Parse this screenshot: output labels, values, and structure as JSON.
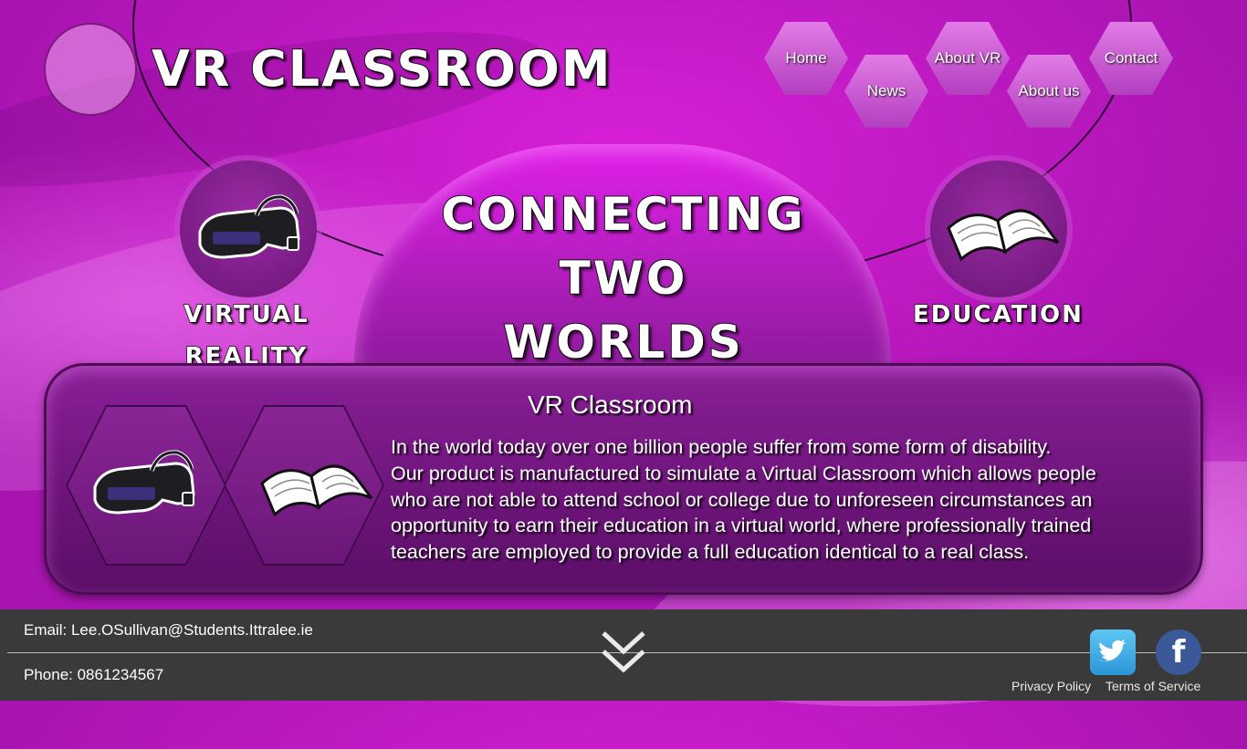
{
  "header": {
    "logo_title": "VR CLASSROOM"
  },
  "nav": {
    "home": "Home",
    "news": "News",
    "about_vr": "About VR",
    "about_us": "About us",
    "contact": "Contact"
  },
  "hero": {
    "line1": "CONNECTING",
    "line2": "TWO",
    "line3": "WORLDS"
  },
  "features": {
    "vr_line1": "VIRTUAL",
    "vr_line2": "REALITY",
    "education": "EDUCATION"
  },
  "panel": {
    "title": "VR Classroom",
    "line1": "In the world today over one billion people suffer from some form of disability.",
    "line2": "Our product is manufactured to simulate a Virtual Classroom which allows people",
    "line3": "who are not able to attend school or college due to unforeseen circumstances an",
    "line4": "opportunity to earn their education in a virtual world, where professionally trained",
    "line5": "teachers are employed to provide a full education identical to a real class."
  },
  "footer": {
    "email": "Email: Lee.OSullivan@Students.Ittralee.ie",
    "phone": "Phone: 0861234567",
    "privacy": "Privacy Policy",
    "terms": "Terms of Service"
  },
  "icons": {
    "twitter": "twitter-icon",
    "facebook": "facebook-icon",
    "scroll": "double-chevron-down-icon",
    "headset": "vr-headset-icon",
    "book": "open-book-icon"
  },
  "colors": {
    "background": "#b41ec0",
    "panel": "#6c1479",
    "footer": "#3a3a3a",
    "nav_hex": "#c95ad2"
  }
}
